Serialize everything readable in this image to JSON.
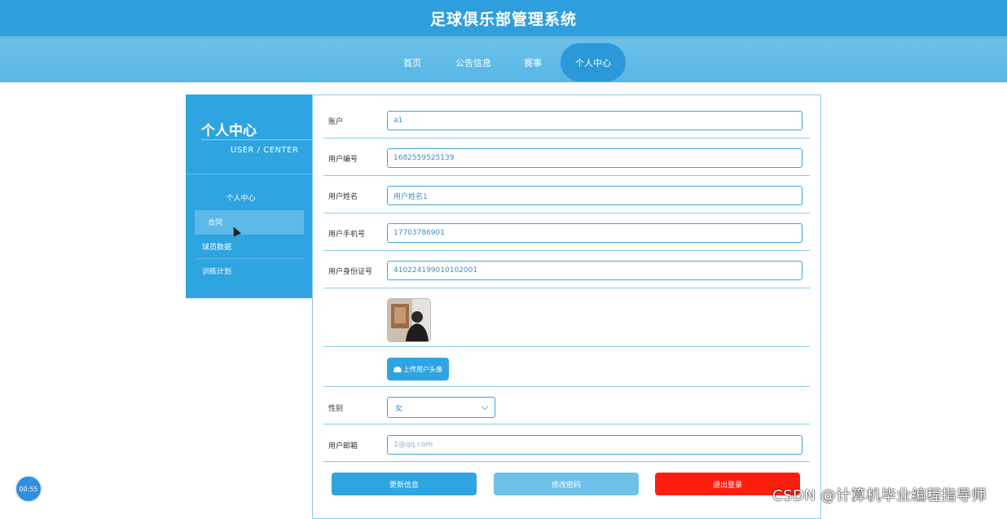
{
  "header": {
    "title": "足球俱乐部管理系统"
  },
  "nav": {
    "items": [
      {
        "label": "首页"
      },
      {
        "label": "公告信息"
      },
      {
        "label": "赛事"
      },
      {
        "label": "个人中心",
        "active": true
      }
    ]
  },
  "sidebar": {
    "title": "个人中心",
    "subtitle": "USER / CENTER",
    "heading": "个人中心",
    "items": [
      {
        "label": "合同",
        "active": true
      },
      {
        "label": "球员数据"
      },
      {
        "label": "训练计划"
      }
    ]
  },
  "form": {
    "account_label": "账户",
    "account_value": "a1",
    "user_no_label": "用户编号",
    "user_no_value": "1682559525139",
    "name_label": "用户姓名",
    "name_value": "用户姓名1",
    "phone_label": "用户手机号",
    "phone_value": "17703786901",
    "id_label": "用户身份证号",
    "id_value": "410224199010102001",
    "upload_label": "上传用户头像",
    "gender_label": "性别",
    "gender_value": "女",
    "email_label": "用户邮箱",
    "email_value": "1@qq.com"
  },
  "actions": {
    "update": "更新信息",
    "change_password": "修改密码",
    "logout": "退出登录"
  },
  "overlay": {
    "timer": "00:55",
    "watermark": "CSDN @计算机毕业编程指导师"
  },
  "colors": {
    "primary": "#2ea4e0",
    "nav": "#58b6e4",
    "password_button": "#6ec2e8",
    "logout_button": "#ff1d0d"
  }
}
